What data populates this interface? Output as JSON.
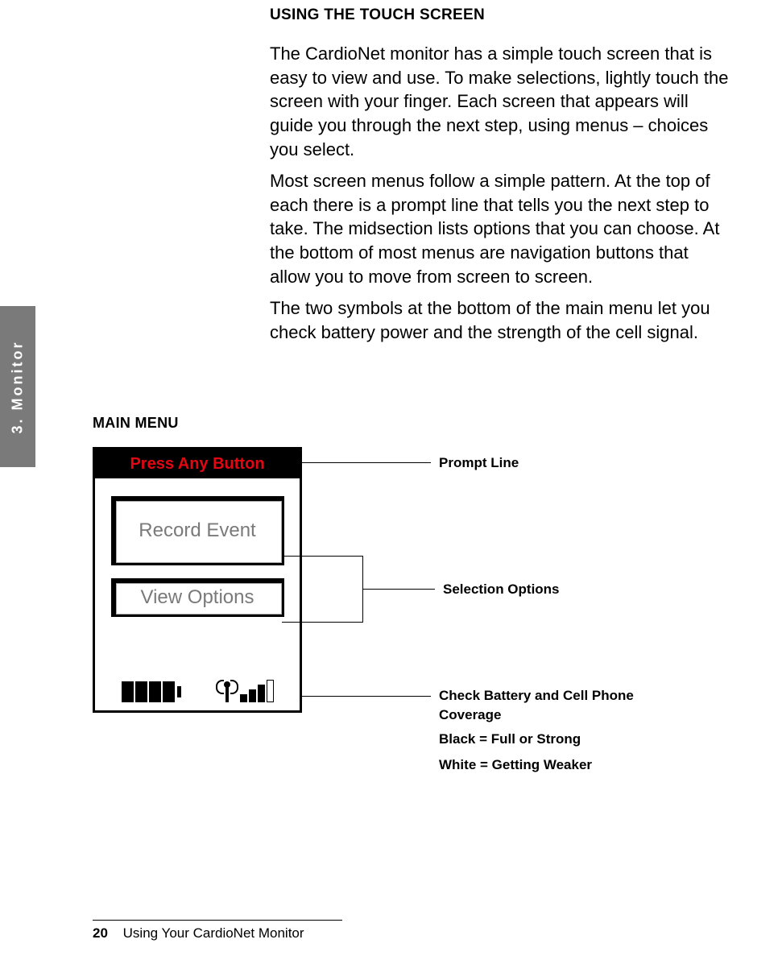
{
  "sideTab": "3. Monitor",
  "heading": "USING THE TOUCH SCREEN",
  "para1": "The CardioNet monitor has a simple touch screen that is easy to view and use. To make selections, lightly touch the screen with your finger. Each screen that appears will guide you through the next step, using menus – choices you select.",
  "para2": "Most screen menus follow a simple pattern.  At the top of each there is a prompt line that tells you the next step to take. The midsection lists options that you can choose. At the bottom of most menus are navigation buttons that allow you to move from screen to screen.",
  "para3": "The two symbols at the bottom of the main menu let you check battery power and the strength of the cell signal.",
  "subheading": "MAIN MENU",
  "device": {
    "promptLine": "Press Any Button",
    "button1": "Record Event",
    "button2": "View Options"
  },
  "callouts": {
    "prompt": "Prompt Line",
    "selection": "Selection Options",
    "status1": "Check Battery and Cell Phone Coverage",
    "status2": "Black = Full or Strong",
    "status3": "White = Getting Weaker"
  },
  "footer": {
    "pageNumber": "20",
    "title": "Using Your CardioNet Monitor"
  }
}
